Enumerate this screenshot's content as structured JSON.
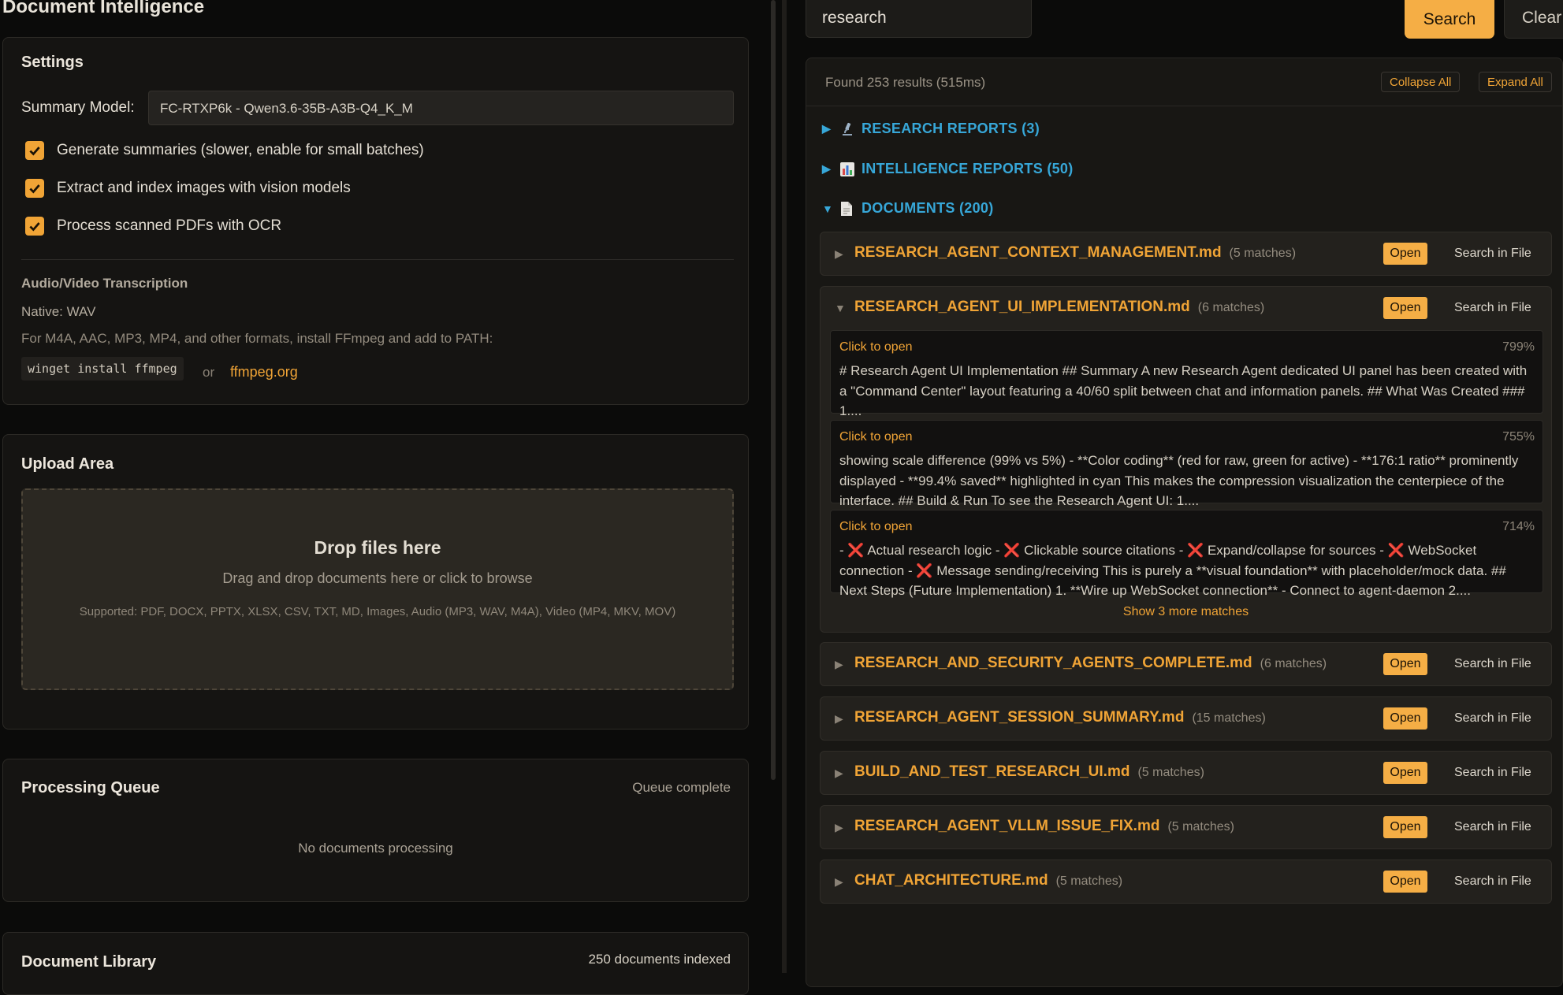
{
  "app": {
    "title": "Document Intelligence"
  },
  "settings": {
    "title": "Settings",
    "model_label": "Summary Model:",
    "model_value": "FC-RTXP6k - Qwen3.6-35B-A3B-Q4_K_M",
    "options": [
      {
        "label": "Generate summaries (slower, enable for small batches)",
        "checked": true
      },
      {
        "label": "Extract and index images with vision models",
        "checked": true
      },
      {
        "label": "Process scanned PDFs with OCR",
        "checked": true
      }
    ],
    "av_title": "Audio/Video Transcription",
    "av_native": "Native: WAV",
    "av_note": "For M4A, AAC, MP3, MP4, and other formats, install FFmpeg and add to PATH:",
    "av_command": "winget install ffmpeg",
    "av_or": "or",
    "av_link": "ffmpeg.org"
  },
  "upload": {
    "title": "Upload Area",
    "drop_title": "Drop files here",
    "drop_subtitle": "Drag and drop documents here or click to browse",
    "supported": "Supported: PDF, DOCX, PPTX, XLSX, CSV, TXT, MD, Images, Audio (MP3, WAV, M4A), Video (MP4, MKV, MOV)"
  },
  "queue": {
    "title": "Processing Queue",
    "status": "Queue complete",
    "empty_text": "No documents processing"
  },
  "library": {
    "title": "Document Library",
    "count": "250 documents indexed"
  },
  "search": {
    "query": "research",
    "search_label": "Search",
    "clear_label": "Clear",
    "found_text": "Found 253 results (515ms)",
    "collapse_all": "Collapse All",
    "expand_all": "Expand All"
  },
  "categories": [
    {
      "label": "RESEARCH REPORTS (3)",
      "icon": "microscope-icon",
      "expanded": false
    },
    {
      "label": "INTELLIGENCE REPORTS (50)",
      "icon": "bar-chart-icon",
      "expanded": false
    },
    {
      "label": "DOCUMENTS (200)",
      "icon": "document-icon",
      "expanded": true
    }
  ],
  "files": [
    {
      "name": "RESEARCH_AGENT_CONTEXT_MANAGEMENT.md",
      "matches": "(5 matches)",
      "expanded": false
    },
    {
      "name": "RESEARCH_AGENT_UI_IMPLEMENTATION.md",
      "matches": "(6 matches)",
      "expanded": true
    },
    {
      "name": "RESEARCH_AND_SECURITY_AGENTS_COMPLETE.md",
      "matches": "(6 matches)",
      "expanded": false
    },
    {
      "name": "RESEARCH_AGENT_SESSION_SUMMARY.md",
      "matches": "(15 matches)",
      "expanded": false
    },
    {
      "name": "BUILD_AND_TEST_RESEARCH_UI.md",
      "matches": "(5 matches)",
      "expanded": false
    },
    {
      "name": "RESEARCH_AGENT_VLLM_ISSUE_FIX.md",
      "matches": "(5 matches)",
      "expanded": false
    },
    {
      "name": "CHAT_ARCHITECTURE.md",
      "matches": "(5 matches)",
      "expanded": false
    }
  ],
  "file_actions": {
    "open": "Open",
    "search_in_file": "Search in File"
  },
  "matches": [
    {
      "click_label": "Click to open",
      "score": "799%",
      "text": "# Research Agent UI Implementation ## Summary A new Research Agent dedicated UI panel has been created with a \"Command Center\" layout featuring a 40/60 split between chat and information panels. ## What Was Created ### 1...."
    },
    {
      "click_label": "Click to open",
      "score": "755%",
      "text": "showing scale difference (99% vs 5%) - **Color coding** (red for raw, green for active) - **176:1 ratio** prominently displayed - **99.4% saved** highlighted in cyan This makes the compression visualization the centerpiece of the interface. ## Build & Run To see the Research Agent UI: 1...."
    },
    {
      "click_label": "Click to open",
      "score": "714%",
      "segments": [
        "- ",
        "❌",
        " Actual research logic - ",
        "❌",
        " Clickable source citations - ",
        "❌",
        " Expand/collapse for sources - ",
        "❌",
        " WebSocket connection - ",
        "❌",
        " Message sending/receiving This is purely a **visual foundation** with placeholder/mock data. ## Next Steps (Future Implementation) 1. **Wire up WebSocket connection** - Connect to agent-daemon 2...."
      ]
    }
  ],
  "show_more": "Show 3 more matches",
  "colors": {
    "accent": "#f0a436",
    "category": "#37a7d8",
    "cross": "#e8365a",
    "background": "#0b0b0a"
  }
}
